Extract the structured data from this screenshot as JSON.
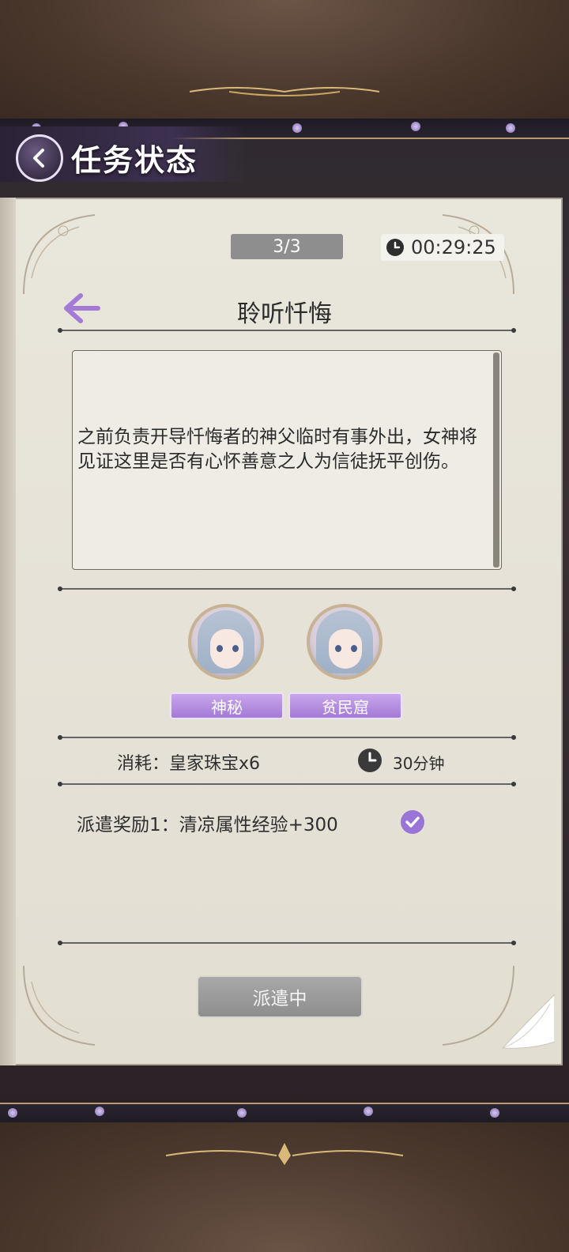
{
  "header": {
    "title": "任务状态"
  },
  "book": {
    "counter": "3/3",
    "timer": "00:29:25",
    "task_title": "聆听忏悔",
    "description": "之前负责开导忏悔者的神父临时有事外出，女神将见证这里是否有心怀善意之人为信徒抚平创伤。",
    "characters": [
      {
        "tag": "神秘"
      },
      {
        "tag": "贫民窟"
      }
    ],
    "cost": "消耗：皇家珠宝x6",
    "duration": "30分钟",
    "reward": "派遣奖励1：清凉属性经验+300",
    "dispatch_button": "派遣中"
  },
  "colors": {
    "accent_purple": "#a37ad6",
    "button_gray": "#8e8e8e",
    "paper": "#e8e5db"
  }
}
